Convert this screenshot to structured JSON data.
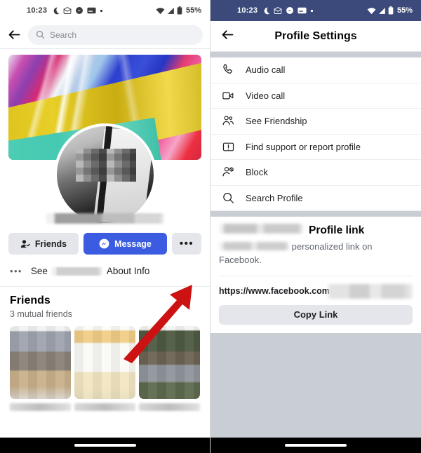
{
  "status_bar": {
    "time": "10:23",
    "battery_percent": "55%",
    "icons": [
      "moon-icon",
      "mail-icon",
      "chat-icon",
      "card-icon",
      "dot-icon"
    ],
    "right_icons": [
      "wifi-icon",
      "signal-icon",
      "battery-icon"
    ],
    "left_bg": "#ffffff",
    "right_bg": "#3b4a7a"
  },
  "left_screen": {
    "search": {
      "placeholder": "Search"
    },
    "back_label": "Back",
    "profile": {
      "name_redacted": true
    },
    "actions": {
      "friends_label": "Friends",
      "message_label": "Message",
      "more_label": "•••"
    },
    "about_row": {
      "dots": "•••",
      "prefix": "See",
      "suffix": "About Info"
    },
    "friends_section": {
      "title": "Friends",
      "subtitle": "3 mutual friends"
    }
  },
  "right_screen": {
    "header": {
      "title": "Profile Settings",
      "back_label": "Back"
    },
    "menu": [
      {
        "label": "Audio call",
        "icon": "phone-icon"
      },
      {
        "label": "Video call",
        "icon": "video-camera-icon"
      },
      {
        "label": "See Friendship",
        "icon": "people-icon"
      },
      {
        "label": "Find support or report profile",
        "icon": "alert-icon"
      },
      {
        "label": "Block",
        "icon": "block-person-icon"
      },
      {
        "label": "Search Profile",
        "icon": "search-icon"
      }
    ],
    "profile_link": {
      "title": "Profile link",
      "description_tail": "personalized link on Facebook.",
      "url_prefix": "https://www.facebook.com",
      "copy_label": "Copy Link"
    }
  },
  "annotations": {
    "arrow_color": "#cc1212",
    "left_target": "more-button",
    "right_target": "menu-item-block"
  }
}
